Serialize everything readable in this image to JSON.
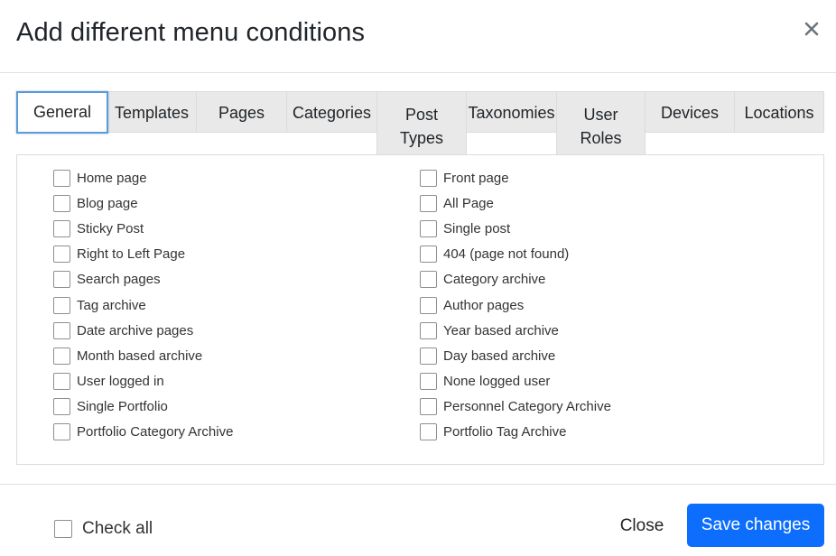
{
  "modal": {
    "title": "Add different menu conditions",
    "close_icon": "close-icon"
  },
  "tabs": [
    {
      "label": "General",
      "active": true
    },
    {
      "label": "Templates"
    },
    {
      "label": "Pages"
    },
    {
      "label": "Categories"
    },
    {
      "label_lines": [
        "Post",
        "Types"
      ]
    },
    {
      "label": "Taxonomies"
    },
    {
      "label_lines": [
        "User",
        "Roles"
      ]
    },
    {
      "label": "Devices"
    },
    {
      "label": "Locations"
    }
  ],
  "options": {
    "left": [
      "Home page",
      "Blog page",
      "Sticky Post",
      "Right to Left Page",
      "Search pages",
      "Tag archive",
      "Date archive pages",
      "Month based archive",
      "User logged in",
      "Single Portfolio",
      "Portfolio Category Archive"
    ],
    "right": [
      "Front page",
      "All Page",
      "Single post",
      "404 (page not found)",
      "Category archive",
      "Author pages",
      "Year based archive",
      "Day based archive",
      "None logged user",
      "Personnel Category Archive",
      "Portfolio Tag Archive"
    ]
  },
  "footer": {
    "check_all_label": "Check all",
    "close_label": "Close",
    "save_label": "Save changes"
  },
  "colors": {
    "primary": "#0d6efd",
    "active_tab_border": "#5b9bd5",
    "tab_bg": "#e9e9e9"
  }
}
